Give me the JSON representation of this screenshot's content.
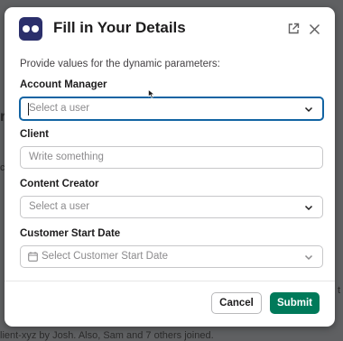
{
  "background": {
    "left_fragment": "r",
    "left_fragment_2": "c",
    "right_fragment": "t",
    "bottom_text": "lient-xyz by Josh. Also, Sam and 7 others joined."
  },
  "modal": {
    "title": "Fill in Your Details",
    "icon": "app-logo-icon",
    "intro": "Provide values for the dynamic parameters:",
    "fields": [
      {
        "label": "Account Manager",
        "placeholder": "Select a user",
        "type": "select"
      },
      {
        "label": "Client",
        "placeholder": "Write something",
        "type": "text"
      },
      {
        "label": "Content Creator",
        "placeholder": "Select a user",
        "type": "select"
      },
      {
        "label": "Customer Start Date",
        "placeholder": "Select Customer Start Date",
        "type": "date"
      }
    ],
    "buttons": {
      "cancel": "Cancel",
      "submit": "Submit"
    }
  },
  "colors": {
    "primary": "#007a5a",
    "focus": "#1264a3",
    "logo": "#2b2f6b"
  }
}
